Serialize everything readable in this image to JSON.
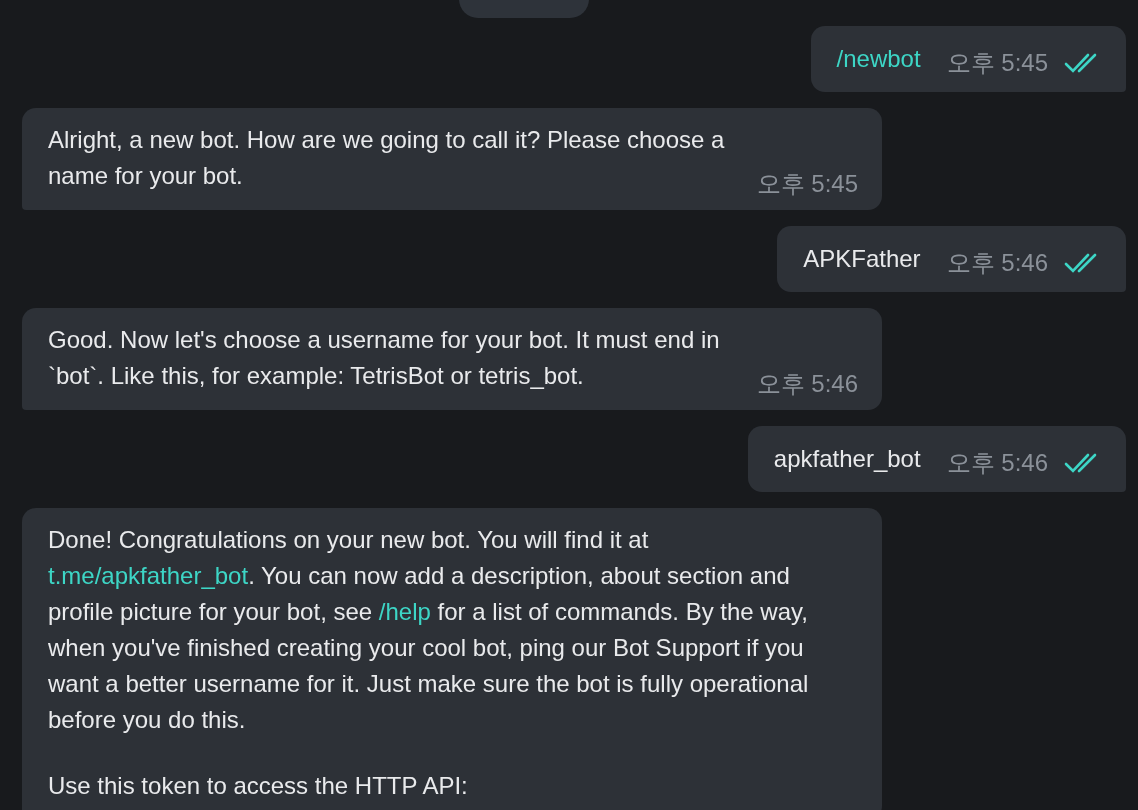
{
  "messages": [
    {
      "kind": "outgoing",
      "paragraphs": [
        [
          {
            "kind": "command",
            "text": "/newbot"
          }
        ]
      ],
      "time": "오후 5:45",
      "read": true
    },
    {
      "kind": "incoming",
      "paragraphs": [
        [
          {
            "kind": "text",
            "text": "Alright, a new bot. How are we going to call it? Please choose a name for your bot."
          }
        ]
      ],
      "time": "오후 5:45"
    },
    {
      "kind": "outgoing",
      "paragraphs": [
        [
          {
            "kind": "text",
            "text": "APKFather"
          }
        ]
      ],
      "time": "오후 5:46",
      "read": true
    },
    {
      "kind": "incoming",
      "paragraphs": [
        [
          {
            "kind": "text",
            "text": "Good. Now let's choose a username for your bot. It must end in `bot`. Like this, for example: TetrisBot or tetris_bot."
          }
        ]
      ],
      "time": "오후 5:46"
    },
    {
      "kind": "outgoing",
      "paragraphs": [
        [
          {
            "kind": "text",
            "text": "apkfather_bot"
          }
        ]
      ],
      "time": "오후 5:46",
      "read": true
    },
    {
      "kind": "incoming",
      "paragraphs": [
        [
          {
            "kind": "text",
            "text": "Done! Congratulations on your new bot. You will find it at "
          },
          {
            "kind": "link",
            "text": "t.me/apkfather_bot"
          },
          {
            "kind": "text",
            "text": ". You can now add a description, about section and profile picture for your bot, see "
          },
          {
            "kind": "command",
            "text": "/help"
          },
          {
            "kind": "text",
            "text": " for a list of commands. By the way, when you've finished creating your cool bot, ping our Bot Support if you want a better username for it. Just make sure the bot is fully operational before you do this."
          }
        ],
        [
          {
            "kind": "text",
            "text": "Use this token to access the HTTP API:"
          }
        ]
      ]
    }
  ]
}
